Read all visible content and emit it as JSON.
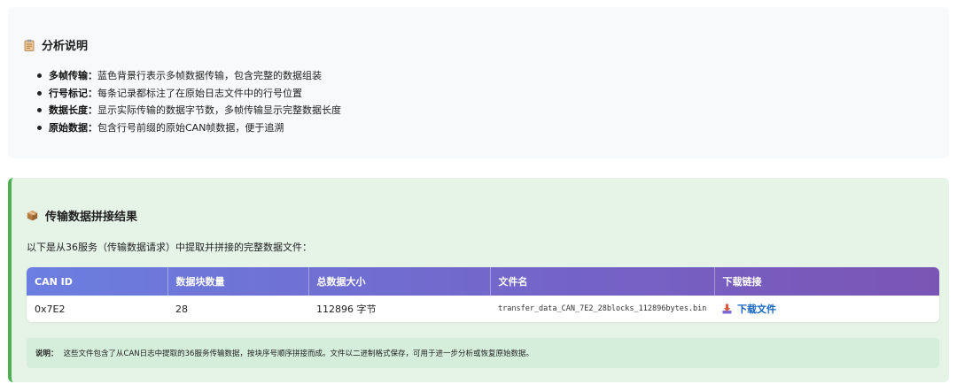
{
  "analysis": {
    "title": "分析说明",
    "icon": "clipboard-icon",
    "items": [
      {
        "term": "多帧传输：",
        "text": "蓝色背景行表示多帧数据传输，包含完整的数据组装"
      },
      {
        "term": "行号标记：",
        "text": "每条记录都标注了在原始日志文件中的行号位置"
      },
      {
        "term": "数据长度：",
        "text": "显示实际传输的数据字节数，多帧传输显示完整数据长度"
      },
      {
        "term": "原始数据：",
        "text": "包含行号前缀的原始CAN帧数据，便于追溯"
      }
    ]
  },
  "result": {
    "title": "传输数据拼接结果",
    "icon": "package-icon",
    "intro": "以下是从36服务（传输数据请求）中提取并拼接的完整数据文件：",
    "table": {
      "headers": [
        "CAN ID",
        "数据块数量",
        "总数据大小",
        "文件名",
        "下载链接"
      ],
      "rows": [
        {
          "can_id": "0x7E2",
          "blocks": "28",
          "size": "112896 字节",
          "filename": "transfer_data_CAN_7E2_28blocks_112896bytes.bin",
          "download_label": "下载文件",
          "download_icon": "download-icon"
        }
      ]
    },
    "note_label": "说明：",
    "note_text": "这些文件包含了从CAN日志中提取的36服务传输数据，按块序号顺序拼接而成。文件以二进制格式保存，可用于进一步分析或恢复原始数据。"
  },
  "colors": {
    "accent_green": "#4caf50",
    "header_gradient_start": "#6b7fe0",
    "header_gradient_end": "#7b55b4",
    "link_blue": "#1565c0"
  }
}
